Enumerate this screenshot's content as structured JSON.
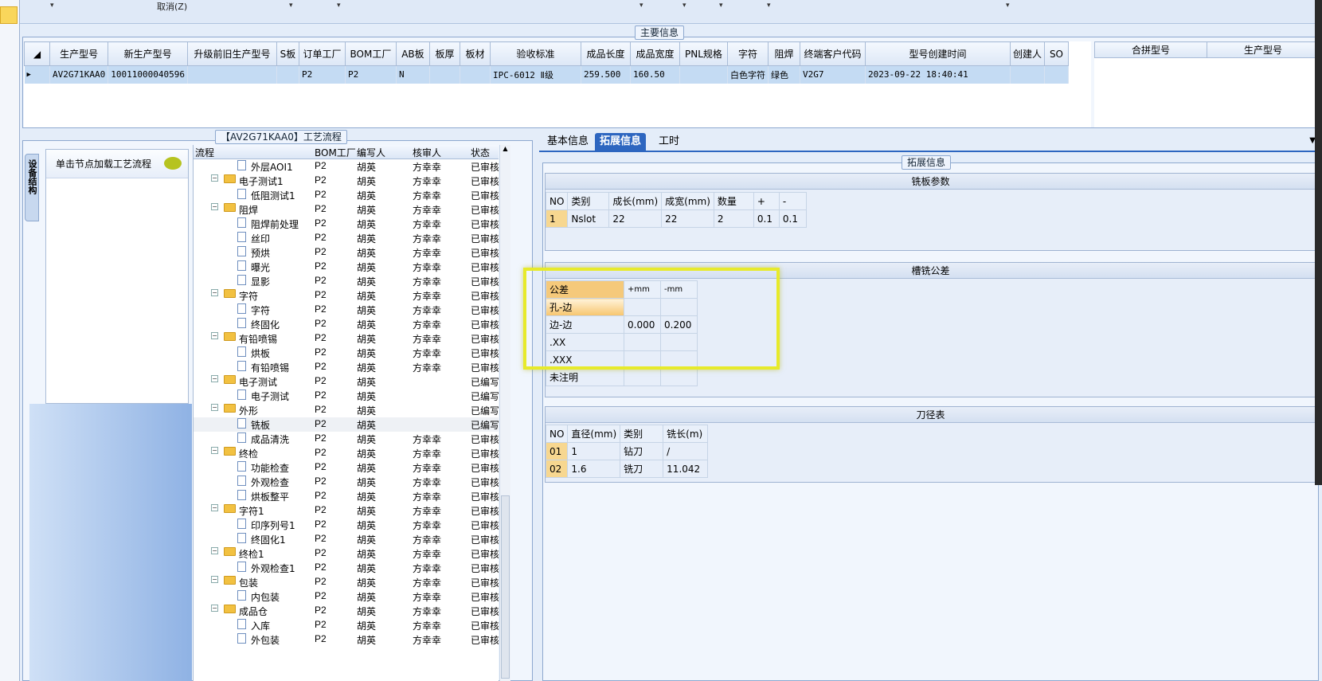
{
  "topbar": {
    "cancel_label": "取消(Z)"
  },
  "main_info": {
    "title": "主要信息",
    "columns": [
      "生产型号",
      "新生产型号",
      "升级前旧生产型号",
      "S板",
      "订单工厂",
      "BOM工厂",
      "AB板",
      "板厚",
      "板材",
      "验收标准",
      "成品长度",
      "成品宽度",
      "PNL规格",
      "字符",
      "阻焊",
      "终端客户代码",
      "型号创建时间",
      "创建人",
      "SO"
    ],
    "row": [
      "AV2G71KAA0",
      "10011000040596",
      "",
      "",
      "P2",
      "P2",
      "N",
      "",
      "",
      "IPC-6012 Ⅱ级",
      "259.500",
      "160.50",
      "",
      "白色字符",
      "绿色",
      "V2G7",
      "2023-09-22 18:40:41",
      "",
      ""
    ],
    "side_columns": [
      "合拼型号",
      "生产型号"
    ]
  },
  "process": {
    "title": "【AV2G71KAA0】工艺流程",
    "side_tab": "设备结构",
    "load_hint": "单击节点加载工艺流程",
    "tree_headers": [
      "流程",
      "BOM工厂",
      "编写人",
      "核审人",
      "状态"
    ],
    "rows": [
      {
        "l": 1,
        "n": "外层AOI1",
        "b": "P2",
        "w": "胡英",
        "r": "方幸幸",
        "s": "已审核"
      },
      {
        "l": 0,
        "n": "电子测试1",
        "b": "P2",
        "w": "胡英",
        "r": "方幸幸",
        "s": "已审核"
      },
      {
        "l": 1,
        "n": "低阻测试1",
        "b": "P2",
        "w": "胡英",
        "r": "方幸幸",
        "s": "已审核"
      },
      {
        "l": 0,
        "n": "阻焊",
        "b": "P2",
        "w": "胡英",
        "r": "方幸幸",
        "s": "已审核"
      },
      {
        "l": 1,
        "n": "阻焊前处理",
        "b": "P2",
        "w": "胡英",
        "r": "方幸幸",
        "s": "已审核"
      },
      {
        "l": 1,
        "n": "丝印",
        "b": "P2",
        "w": "胡英",
        "r": "方幸幸",
        "s": "已审核"
      },
      {
        "l": 1,
        "n": "预烘",
        "b": "P2",
        "w": "胡英",
        "r": "方幸幸",
        "s": "已审核"
      },
      {
        "l": 1,
        "n": "曝光",
        "b": "P2",
        "w": "胡英",
        "r": "方幸幸",
        "s": "已审核"
      },
      {
        "l": 1,
        "n": "显影",
        "b": "P2",
        "w": "胡英",
        "r": "方幸幸",
        "s": "已审核"
      },
      {
        "l": 0,
        "n": "字符",
        "b": "P2",
        "w": "胡英",
        "r": "方幸幸",
        "s": "已审核"
      },
      {
        "l": 1,
        "n": "字符",
        "b": "P2",
        "w": "胡英",
        "r": "方幸幸",
        "s": "已审核"
      },
      {
        "l": 1,
        "n": "终固化",
        "b": "P2",
        "w": "胡英",
        "r": "方幸幸",
        "s": "已审核"
      },
      {
        "l": 0,
        "n": "有铅喷锡",
        "b": "P2",
        "w": "胡英",
        "r": "方幸幸",
        "s": "已审核"
      },
      {
        "l": 1,
        "n": "烘板",
        "b": "P2",
        "w": "胡英",
        "r": "方幸幸",
        "s": "已审核"
      },
      {
        "l": 1,
        "n": "有铅喷锡",
        "b": "P2",
        "w": "胡英",
        "r": "方幸幸",
        "s": "已审核"
      },
      {
        "l": 0,
        "n": "电子测试",
        "b": "P2",
        "w": "胡英",
        "r": "",
        "s": "已编写"
      },
      {
        "l": 1,
        "n": "电子测试",
        "b": "P2",
        "w": "胡英",
        "r": "",
        "s": "已编写"
      },
      {
        "l": 0,
        "n": "外形",
        "b": "P2",
        "w": "胡英",
        "r": "",
        "s": "已编写"
      },
      {
        "l": 1,
        "n": "铣板",
        "b": "P2",
        "w": "胡英",
        "r": "",
        "s": "已编写"
      },
      {
        "l": 1,
        "n": "成品清洗",
        "b": "P2",
        "w": "胡英",
        "r": "方幸幸",
        "s": "已审核"
      },
      {
        "l": 0,
        "n": "终检",
        "b": "P2",
        "w": "胡英",
        "r": "方幸幸",
        "s": "已审核"
      },
      {
        "l": 1,
        "n": "功能检查",
        "b": "P2",
        "w": "胡英",
        "r": "方幸幸",
        "s": "已审核"
      },
      {
        "l": 1,
        "n": "外观检查",
        "b": "P2",
        "w": "胡英",
        "r": "方幸幸",
        "s": "已审核"
      },
      {
        "l": 1,
        "n": "烘板整平",
        "b": "P2",
        "w": "胡英",
        "r": "方幸幸",
        "s": "已审核"
      },
      {
        "l": 0,
        "n": "字符1",
        "b": "P2",
        "w": "胡英",
        "r": "方幸幸",
        "s": "已审核"
      },
      {
        "l": 1,
        "n": "印序列号1",
        "b": "P2",
        "w": "胡英",
        "r": "方幸幸",
        "s": "已审核"
      },
      {
        "l": 1,
        "n": "终固化1",
        "b": "P2",
        "w": "胡英",
        "r": "方幸幸",
        "s": "已审核"
      },
      {
        "l": 0,
        "n": "终检1",
        "b": "P2",
        "w": "胡英",
        "r": "方幸幸",
        "s": "已审核"
      },
      {
        "l": 1,
        "n": "外观检查1",
        "b": "P2",
        "w": "胡英",
        "r": "方幸幸",
        "s": "已审核"
      },
      {
        "l": 0,
        "n": "包装",
        "b": "P2",
        "w": "胡英",
        "r": "方幸幸",
        "s": "已审核"
      },
      {
        "l": 1,
        "n": "内包装",
        "b": "P2",
        "w": "胡英",
        "r": "方幸幸",
        "s": "已审核"
      },
      {
        "l": 0,
        "n": "成品仓",
        "b": "P2",
        "w": "胡英",
        "r": "方幸幸",
        "s": "已审核"
      },
      {
        "l": 1,
        "n": "入库",
        "b": "P2",
        "w": "胡英",
        "r": "方幸幸",
        "s": "已审核"
      },
      {
        "l": 1,
        "n": "外包装",
        "b": "P2",
        "w": "胡英",
        "r": "方幸幸",
        "s": "已审核"
      }
    ]
  },
  "right": {
    "tabs": [
      "基本信息",
      "拓展信息",
      "工时"
    ],
    "ext_title": "拓展信息",
    "mill": {
      "title": "铣板参数",
      "headers": [
        "NO",
        "类别",
        "成长(mm)",
        "成宽(mm)",
        "数量",
        "+",
        "-"
      ],
      "rows": [
        [
          "1",
          "Nslot",
          "22",
          "22",
          "2",
          "0.1",
          "0.1"
        ]
      ]
    },
    "tolerance": {
      "title": "槽铣公差",
      "headers": [
        "公差",
        "+mm",
        "-mm"
      ],
      "rows": [
        [
          "孔-边",
          "",
          ""
        ],
        [
          "边-边",
          "0.000",
          "0.200"
        ],
        [
          ".XX",
          "",
          ""
        ],
        [
          ".XXX",
          "",
          ""
        ],
        [
          "未注明",
          "",
          ""
        ]
      ]
    },
    "tool": {
      "title": "刀径表",
      "headers": [
        "NO",
        "直径(mm)",
        "类别",
        "铣长(m)"
      ],
      "rows": [
        [
          "01",
          "1",
          "钻刀",
          "/"
        ],
        [
          "02",
          "1.6",
          "铣刀",
          "11.042"
        ]
      ]
    }
  }
}
